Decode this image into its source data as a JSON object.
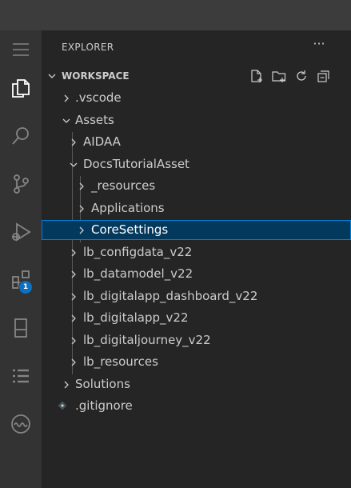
{
  "sidebar": {
    "title": "EXPLORER",
    "more_label": "···",
    "workspace": {
      "title": "WORKSPACE",
      "actions": [
        "new-file-icon",
        "new-folder-icon",
        "refresh-icon",
        "collapse-all-icon"
      ]
    },
    "tree": [
      {
        "label": ".vscode",
        "depth": 1,
        "type": "folder",
        "expanded": false
      },
      {
        "label": "Assets",
        "depth": 1,
        "type": "folder",
        "expanded": true
      },
      {
        "label": "AIDAA",
        "depth": 2,
        "type": "folder",
        "expanded": false
      },
      {
        "label": "DocsTutorialAsset",
        "depth": 2,
        "type": "folder",
        "expanded": true
      },
      {
        "label": "_resources",
        "depth": 3,
        "type": "folder",
        "expanded": false
      },
      {
        "label": "Applications",
        "depth": 3,
        "type": "folder",
        "expanded": false
      },
      {
        "label": "CoreSettings",
        "depth": 3,
        "type": "folder",
        "expanded": false,
        "selected": true
      },
      {
        "label": "lb_configdata_v22",
        "depth": 2,
        "type": "folder",
        "expanded": false
      },
      {
        "label": "lb_datamodel_v22",
        "depth": 2,
        "type": "folder",
        "expanded": false
      },
      {
        "label": "lb_digitalapp_dashboard_v22",
        "depth": 2,
        "type": "folder",
        "expanded": false
      },
      {
        "label": "lb_digitalapp_v22",
        "depth": 2,
        "type": "folder",
        "expanded": false
      },
      {
        "label": "lb_digitaljourney_v22",
        "depth": 2,
        "type": "folder",
        "expanded": false
      },
      {
        "label": "lb_resources",
        "depth": 2,
        "type": "folder",
        "expanded": false
      },
      {
        "label": "Solutions",
        "depth": 1,
        "type": "folder",
        "expanded": false
      },
      {
        "label": ".gitignore",
        "depth": 1,
        "type": "file"
      }
    ]
  },
  "activity_bar": {
    "items": [
      "menu-icon",
      "explorer-icon",
      "search-icon",
      "source-control-icon",
      "run-debug-icon",
      "extensions-icon",
      "panel-icon",
      "list-icon",
      "remote-icon"
    ],
    "extensions_badge": "1"
  },
  "colors": {
    "selection_bg": "#04395e",
    "selection_border": "#007fd4",
    "badge": "#0e70c0"
  }
}
